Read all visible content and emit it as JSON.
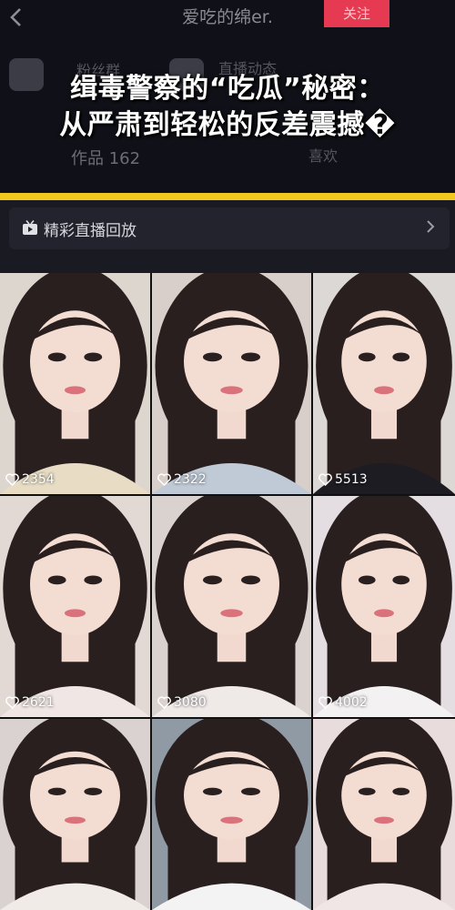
{
  "profile": {
    "name": "爱吃的绵er.",
    "follow_label": "关注",
    "fans_label": "粉丝群",
    "live_label": "直播动态",
    "works": "作品 162",
    "likes_tab": "喜欢",
    "accent": "#e63a52"
  },
  "headline": {
    "line1": "缉毒警察的“吃瓜”秘密：",
    "line2": "从严肃到轻松的反差震撼�",
    "banner_color": "#f2c81f"
  },
  "replay": {
    "label": "精彩直播回放",
    "icon": "tv-icon"
  },
  "videos": [
    {
      "likes": "2354",
      "bg": "#dcd6cf",
      "shirt": "#e8ddc4"
    },
    {
      "likes": "2322",
      "bg": "#d9cfca",
      "shirt": "#bfcad6"
    },
    {
      "likes": "5513",
      "bg": "#dcd8d6",
      "shirt": "#1c1c22"
    },
    {
      "likes": "2621",
      "bg": "#e2d8d4",
      "shirt": "#f0e7e4"
    },
    {
      "likes": "3080",
      "bg": "#dad2cf",
      "shirt": "#efe9e8"
    },
    {
      "likes": "4002",
      "bg": "#e4dde2",
      "shirt": "#f3f1f2"
    },
    {
      "likes": "",
      "bg": "#d9d2d0",
      "shirt": "#f1ebe8"
    },
    {
      "likes": "",
      "bg": "#8f9aa5",
      "shirt": "#f4f3f4"
    },
    {
      "likes": "",
      "bg": "#e9dcdc",
      "shirt": "#f0e6e6"
    }
  ]
}
